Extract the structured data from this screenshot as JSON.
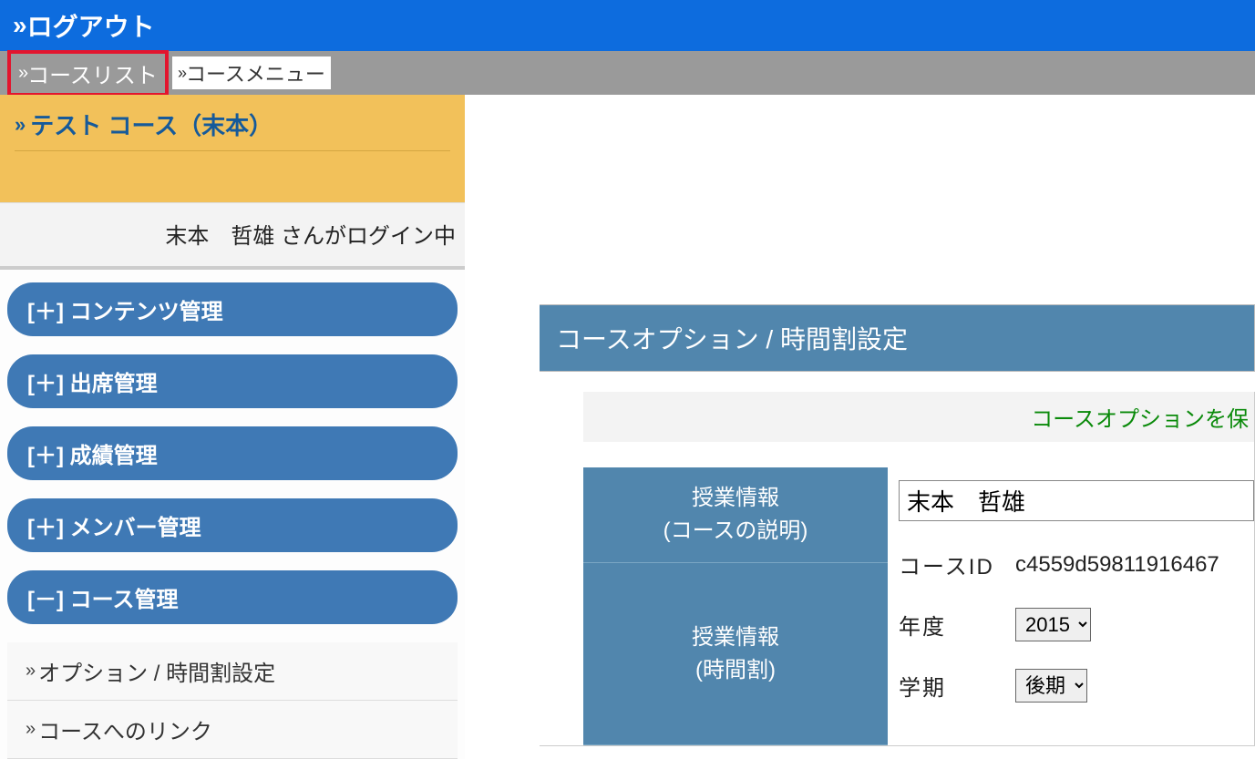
{
  "header": {
    "logout_label": "ログアウト"
  },
  "breadcrumb": {
    "course_list_label": "コースリスト",
    "course_menu_label": "コースメニュー"
  },
  "course": {
    "title": "テスト コース（末本）"
  },
  "login_status": "末本　哲雄 さんがログイン中",
  "sidebar": {
    "items": [
      {
        "label": "[＋] コンテンツ管理"
      },
      {
        "label": "[＋] 出席管理"
      },
      {
        "label": "[＋] 成績管理"
      },
      {
        "label": "[＋] メンバー管理"
      },
      {
        "label": "[－] コース管理"
      }
    ],
    "subitems": [
      {
        "label": "オプション / 時間割設定"
      },
      {
        "label": "コースへのリンク"
      }
    ]
  },
  "main": {
    "panel_title": "コースオプション / 時間割設定",
    "success_msg": "コースオプションを保",
    "left_head1_line1": "授業情報",
    "left_head1_line2": "(コースの説明)",
    "left_head2_line1": "授業情報",
    "left_head2_line2": "(時間割)",
    "name_value": "末本　哲雄",
    "course_id_label": "コースID",
    "course_id_value": "c4559d59811916467",
    "year_label": "年度",
    "year_value": "2015",
    "term_label": "学期",
    "term_value": "後期"
  }
}
